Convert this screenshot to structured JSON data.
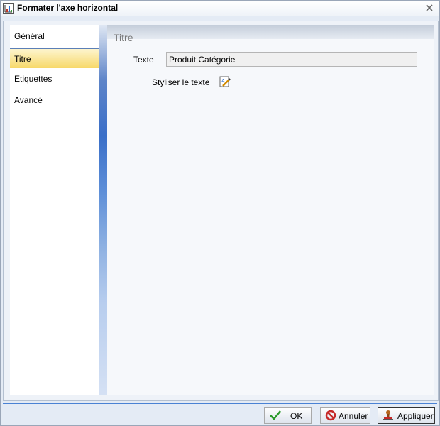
{
  "window": {
    "title": "Formater l'axe horizontal"
  },
  "nav": {
    "items": [
      {
        "label": "Général"
      },
      {
        "label": "Titre"
      },
      {
        "label": "Etiquettes"
      },
      {
        "label": "Avancé"
      }
    ],
    "selected": "Titre"
  },
  "section": {
    "title": "Titre",
    "text_label": "Texte",
    "text_value": "Produit Catégorie",
    "style_label": "Styliser le texte"
  },
  "buttons": {
    "ok": "OK",
    "cancel": "Annuler",
    "apply": "Appliquer"
  },
  "colors": {
    "accent": "#4a82d4",
    "selected_item": "#f7d869",
    "strip": "#3a6fc8"
  },
  "icons": {
    "app": "chart-axis-icon",
    "close": "close-icon",
    "style": "style-text-icon",
    "ok": "checkmark-icon",
    "cancel": "no-sign-icon",
    "apply": "stamp-icon"
  }
}
